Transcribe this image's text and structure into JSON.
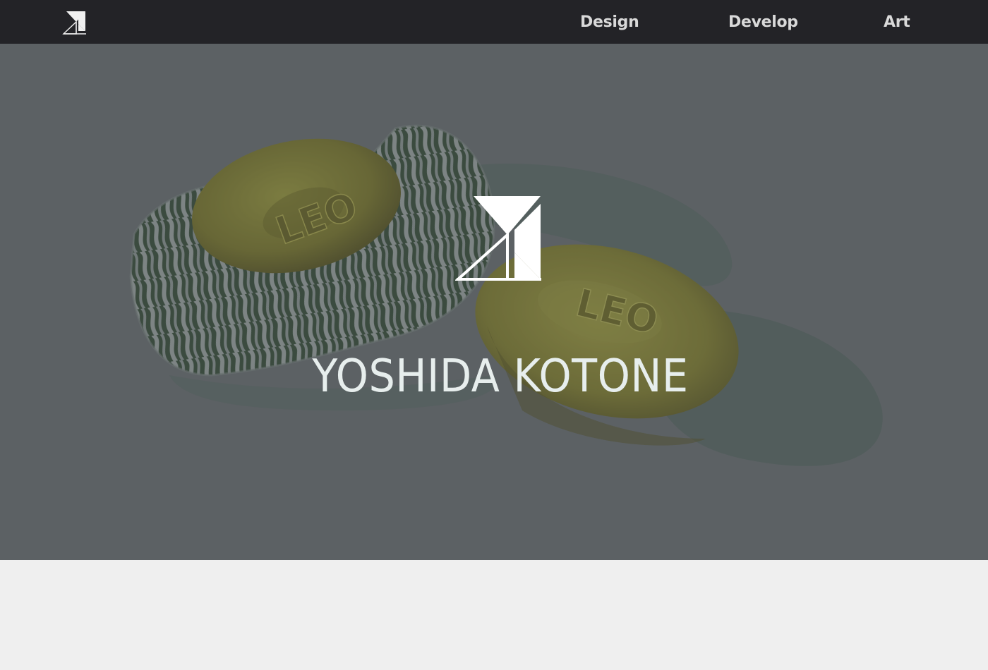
{
  "nav": {
    "logo_icon": "kotone-monogram-icon",
    "links": [
      {
        "label": "Design"
      },
      {
        "label": "Develop"
      },
      {
        "label": "Art"
      }
    ]
  },
  "hero": {
    "logo_icon": "kotone-monogram-icon",
    "title": "YOSHIDA KOTONE",
    "image_description_icon": "candy-illustration",
    "candy_stamp": "LEO"
  },
  "colors": {
    "nav_bg": "#232327",
    "nav_text": "#d9d9d9",
    "hero_overlay": "#5c6164",
    "title_text": "#e7eeed",
    "page_bg": "#efefef"
  }
}
